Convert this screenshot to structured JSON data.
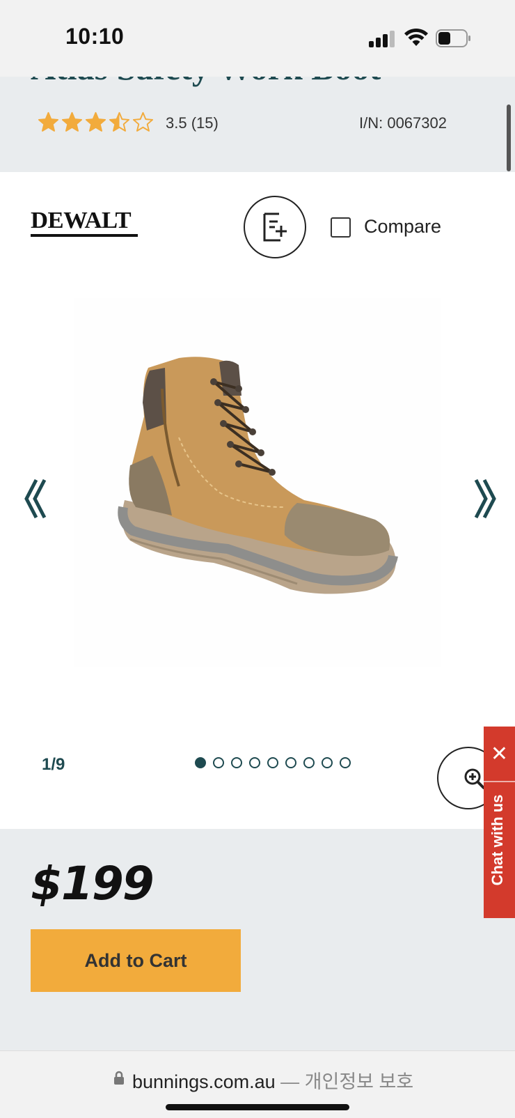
{
  "status_bar": {
    "time": "10:10"
  },
  "product": {
    "title_partial": "Atlas Safety Work Boot",
    "rating": "3.5 (15)",
    "rating_value": 3.5,
    "rating_max": 5,
    "item_number": "I/N: 0067302",
    "brand": "DEWALT",
    "compare_label": "Compare",
    "price": "$199",
    "add_to_cart_label": "Add to Cart"
  },
  "carousel": {
    "counter": "1/9",
    "total": 9,
    "active_index": 0
  },
  "chat": {
    "close_symbol": "✕",
    "label": "Chat with us"
  },
  "browser": {
    "domain": "bunnings.com.au",
    "suffix": " — 개인정보 보호"
  },
  "colors": {
    "accent_teal": "#1e4a50",
    "star": "#f2ab3c",
    "cart_button": "#f2ab3c",
    "chat_red": "#d33a2c",
    "band_grey": "#e9ecee"
  },
  "icons": {
    "list_add": "add-to-list-icon",
    "zoom": "zoom-in-icon",
    "prev": "double-chevron-left-icon",
    "next": "double-chevron-right-icon",
    "lock": "lock-icon"
  }
}
